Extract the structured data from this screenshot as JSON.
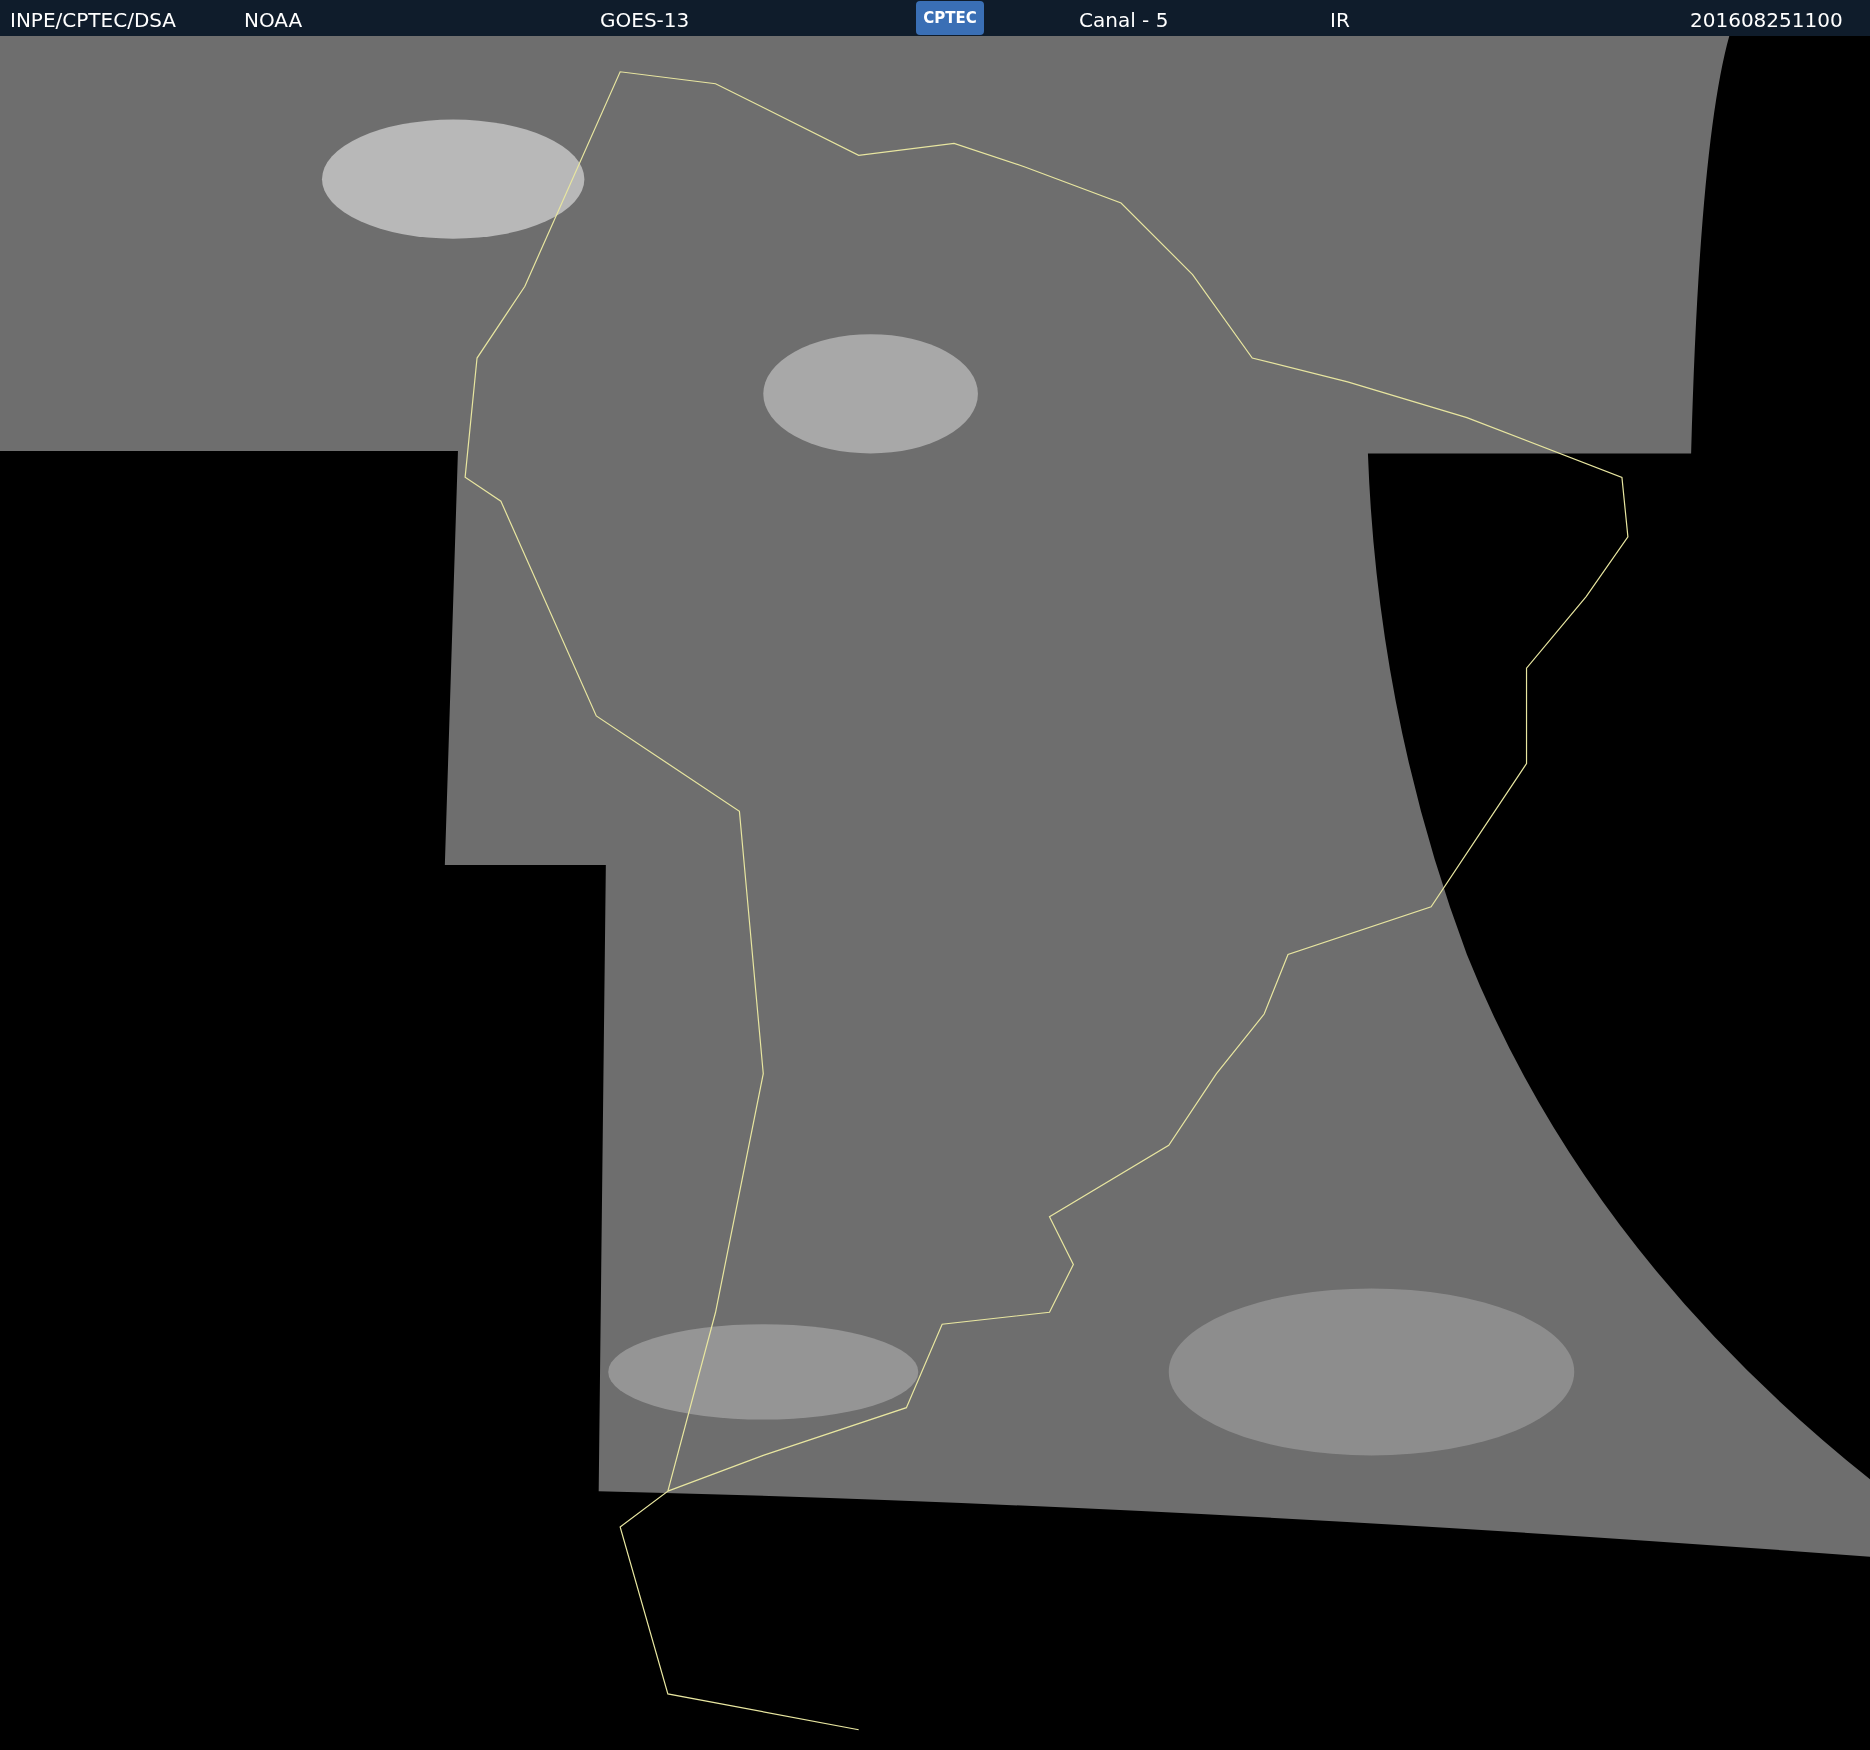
{
  "header": {
    "items": [
      {
        "kind": "text",
        "label": "INPE/CPTEC/DSA"
      },
      {
        "kind": "text",
        "label": "NOAA"
      },
      {
        "kind": "text",
        "label": "GOES-13"
      },
      {
        "kind": "logo",
        "label": "CPTEC"
      },
      {
        "kind": "text",
        "label": "Canal - 5"
      },
      {
        "kind": "text",
        "label": "IR"
      },
      {
        "kind": "text",
        "label": "201608251100"
      }
    ]
  }
}
